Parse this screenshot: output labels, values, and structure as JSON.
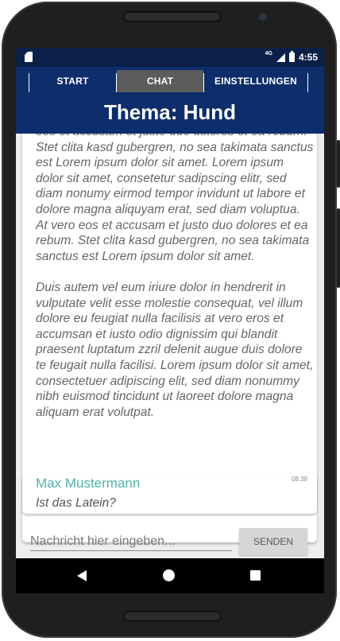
{
  "tabs": [
    {
      "label": "START",
      "active": false
    },
    {
      "label": "CHAT",
      "active": true
    },
    {
      "label": "EINSTELLUNGEN",
      "active": false
    }
  ],
  "status_bar": {
    "network": "4G",
    "time": "4:55"
  },
  "topic": {
    "title": "Thema: Hund"
  },
  "messages": [
    {
      "text": "eos et accusam et justo duo dolores et ea rebum. Stet clita kasd gubergren, no sea takimata sanctus est Lorem ipsum dolor sit amet. Lorem ipsum dolor sit amet, consetetur sadipscing elitr, sed diam nonumy eirmod tempor invidunt ut labore et dolore magna aliquyam erat, sed diam voluptua. At vero eos et accusam et justo duo dolores et ea rebum. Stet clita kasd gubergren, no sea takimata sanctus est Lorem ipsum dolor sit amet.\n\nDuis autem vel eum iriure dolor in hendrerit in vulputate velit esse molestie consequat, vel illum dolore eu feugiat nulla facilisis at vero eros et accumsan et iusto odio dignissim qui blandit praesent luptatum zzril delenit augue duis dolore te feugait nulla facilisi. Lorem ipsum dolor sit amet, consectetuer adipiscing elit, sed diam nonummy nibh euismod tincidunt ut laoreet dolore magna aliquam erat volutpat."
    },
    {
      "sender": "Max Mustermann",
      "time": "08:39",
      "text": "Ist das Latein?"
    }
  ],
  "composer": {
    "placeholder": "Nachricht hier eingeben...",
    "value": "",
    "send_label": "SENDEN"
  },
  "colors": {
    "app_bar": "#0d2d6b",
    "status_bar": "#0a2048",
    "active_tab": "#5c5c5c",
    "sender_name": "#4fb3aa"
  }
}
